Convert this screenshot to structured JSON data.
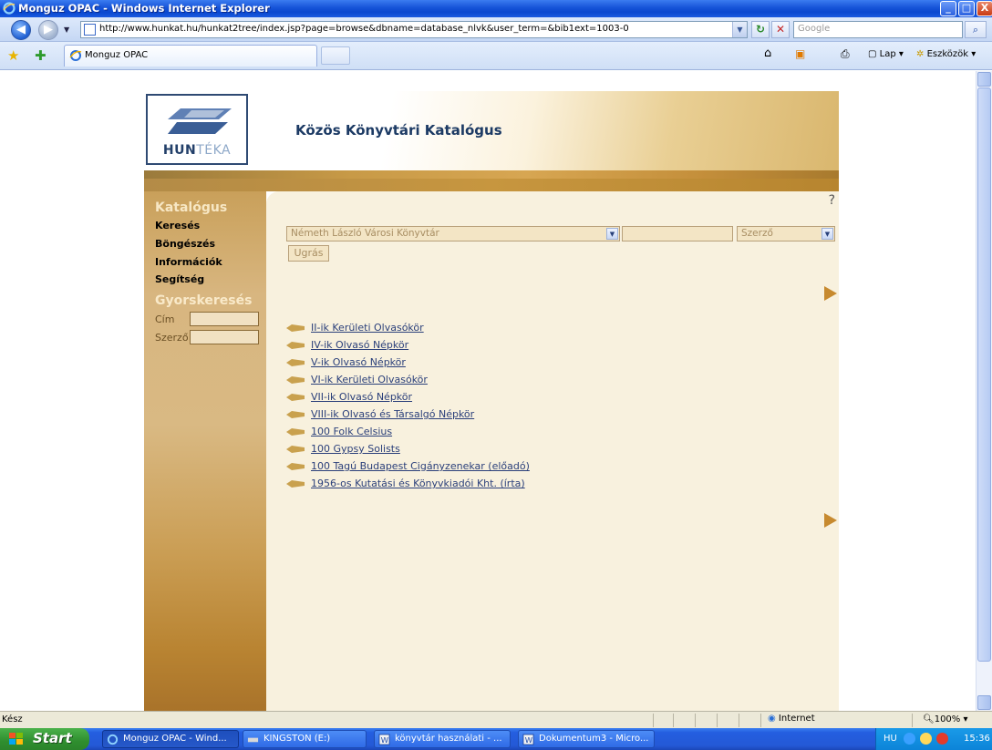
{
  "window": {
    "title": "Monguz OPAC - Windows Internet Explorer",
    "minimize": "_",
    "maximize": "□",
    "close": "X"
  },
  "address_bar": {
    "url": "http://www.hunkat.hu/hunkat2tree/index.jsp?page=browse&dbname=database_nlvk&user_term=&bib1ext=1003-0",
    "search_placeholder": "Google"
  },
  "tab": {
    "label": "Monguz OPAC"
  },
  "toolbar": {
    "page_label": "Lap",
    "tools_label": "Eszközök"
  },
  "header": {
    "logo_text_bold": "HUN",
    "logo_text_light": "TÉKA",
    "title": "Közös Könyvtári Katalógus"
  },
  "sidebar": {
    "katalogus_heading": "Katalógus",
    "links": [
      "Keresés",
      "Böngészés",
      "Információk",
      "Segítség"
    ],
    "quicksearch_heading": "Gyorskeresés",
    "field_title": "Cím",
    "field_author": "Szerző"
  },
  "main": {
    "help": "?",
    "library_select": "Németh László Városi Könyvtár",
    "field_select": "Szerző",
    "jump_button": "Ugrás",
    "entries": [
      "II-ik Kerületi Olvasókör",
      "IV-ik Olvasó Népkör",
      "V-ik Olvasó Népkör",
      "VI-ik Kerületi Olvasókör",
      "VII-ik Olvasó Népkör",
      "VIII-ik Olvasó és Társalgó Népkör",
      "100 Folk Celsius",
      "100 Gypsy Solists",
      "100 Tagú Budapest Cigányzenekar (előadó)",
      "1956-os Kutatási és Könyvkiadói Kht. (írta)"
    ]
  },
  "statusbar": {
    "status": "Kész",
    "zone": "Internet",
    "zoom": "100%"
  },
  "taskbar": {
    "start": "Start",
    "items": [
      "Monguz OPAC - Wind...",
      "KINGSTON (E:)",
      "könyvtár használati - ...",
      "Dokumentum3 - Micro..."
    ],
    "language": "HU",
    "clock": "15:36"
  },
  "colors": {
    "sidebar_gold": "#d8b680",
    "main_bg": "#f8f1de",
    "link": "#2a3f7a",
    "title_blue": "#1c3a64"
  }
}
